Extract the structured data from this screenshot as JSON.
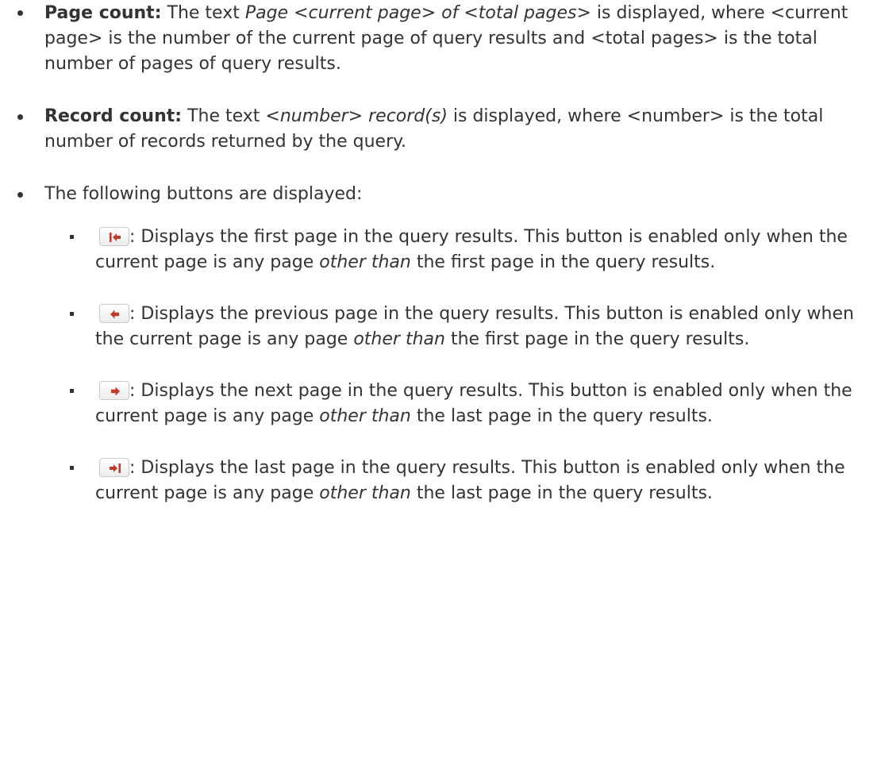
{
  "page_count": {
    "label": "Page count:",
    "text_a": " The text ",
    "italic": "Page <current page> of <total pages>",
    "text_b": " is displayed, where <current page> is the number of the current page of query results and <total pages> is the total number of pages of query results."
  },
  "record_count": {
    "label": "Record count:",
    "text_a": " The text ",
    "italic": "<number> record(s)",
    "text_b": " is displayed, where <number> is the total number of records returned by the query."
  },
  "buttons_intro": "The following buttons are displayed:",
  "buttons": [
    {
      "icon": "first-page-icon",
      "text_a": ": Displays the first page in the query results. This button is enabled only when the current page is any page ",
      "italic": "other than",
      "text_b": " the first page in the query results."
    },
    {
      "icon": "previous-page-icon",
      "text_a": ": Displays the previous page in the query results. This button is enabled only when the current page is any page ",
      "italic": "other than",
      "text_b": " the first page in the query results."
    },
    {
      "icon": "next-page-icon",
      "text_a": ": Displays the next page in the query results. This button is enabled only when the current page is any page ",
      "italic": "other than",
      "text_b": " the last page in the query results."
    },
    {
      "icon": "last-page-icon",
      "text_a": ": Displays the last page in the query results. This button is enabled only when the current page is any page ",
      "italic": "other than",
      "text_b": " the last page in the query results."
    }
  ],
  "colors": {
    "text": "#333333",
    "arrow": "#c0392b"
  }
}
